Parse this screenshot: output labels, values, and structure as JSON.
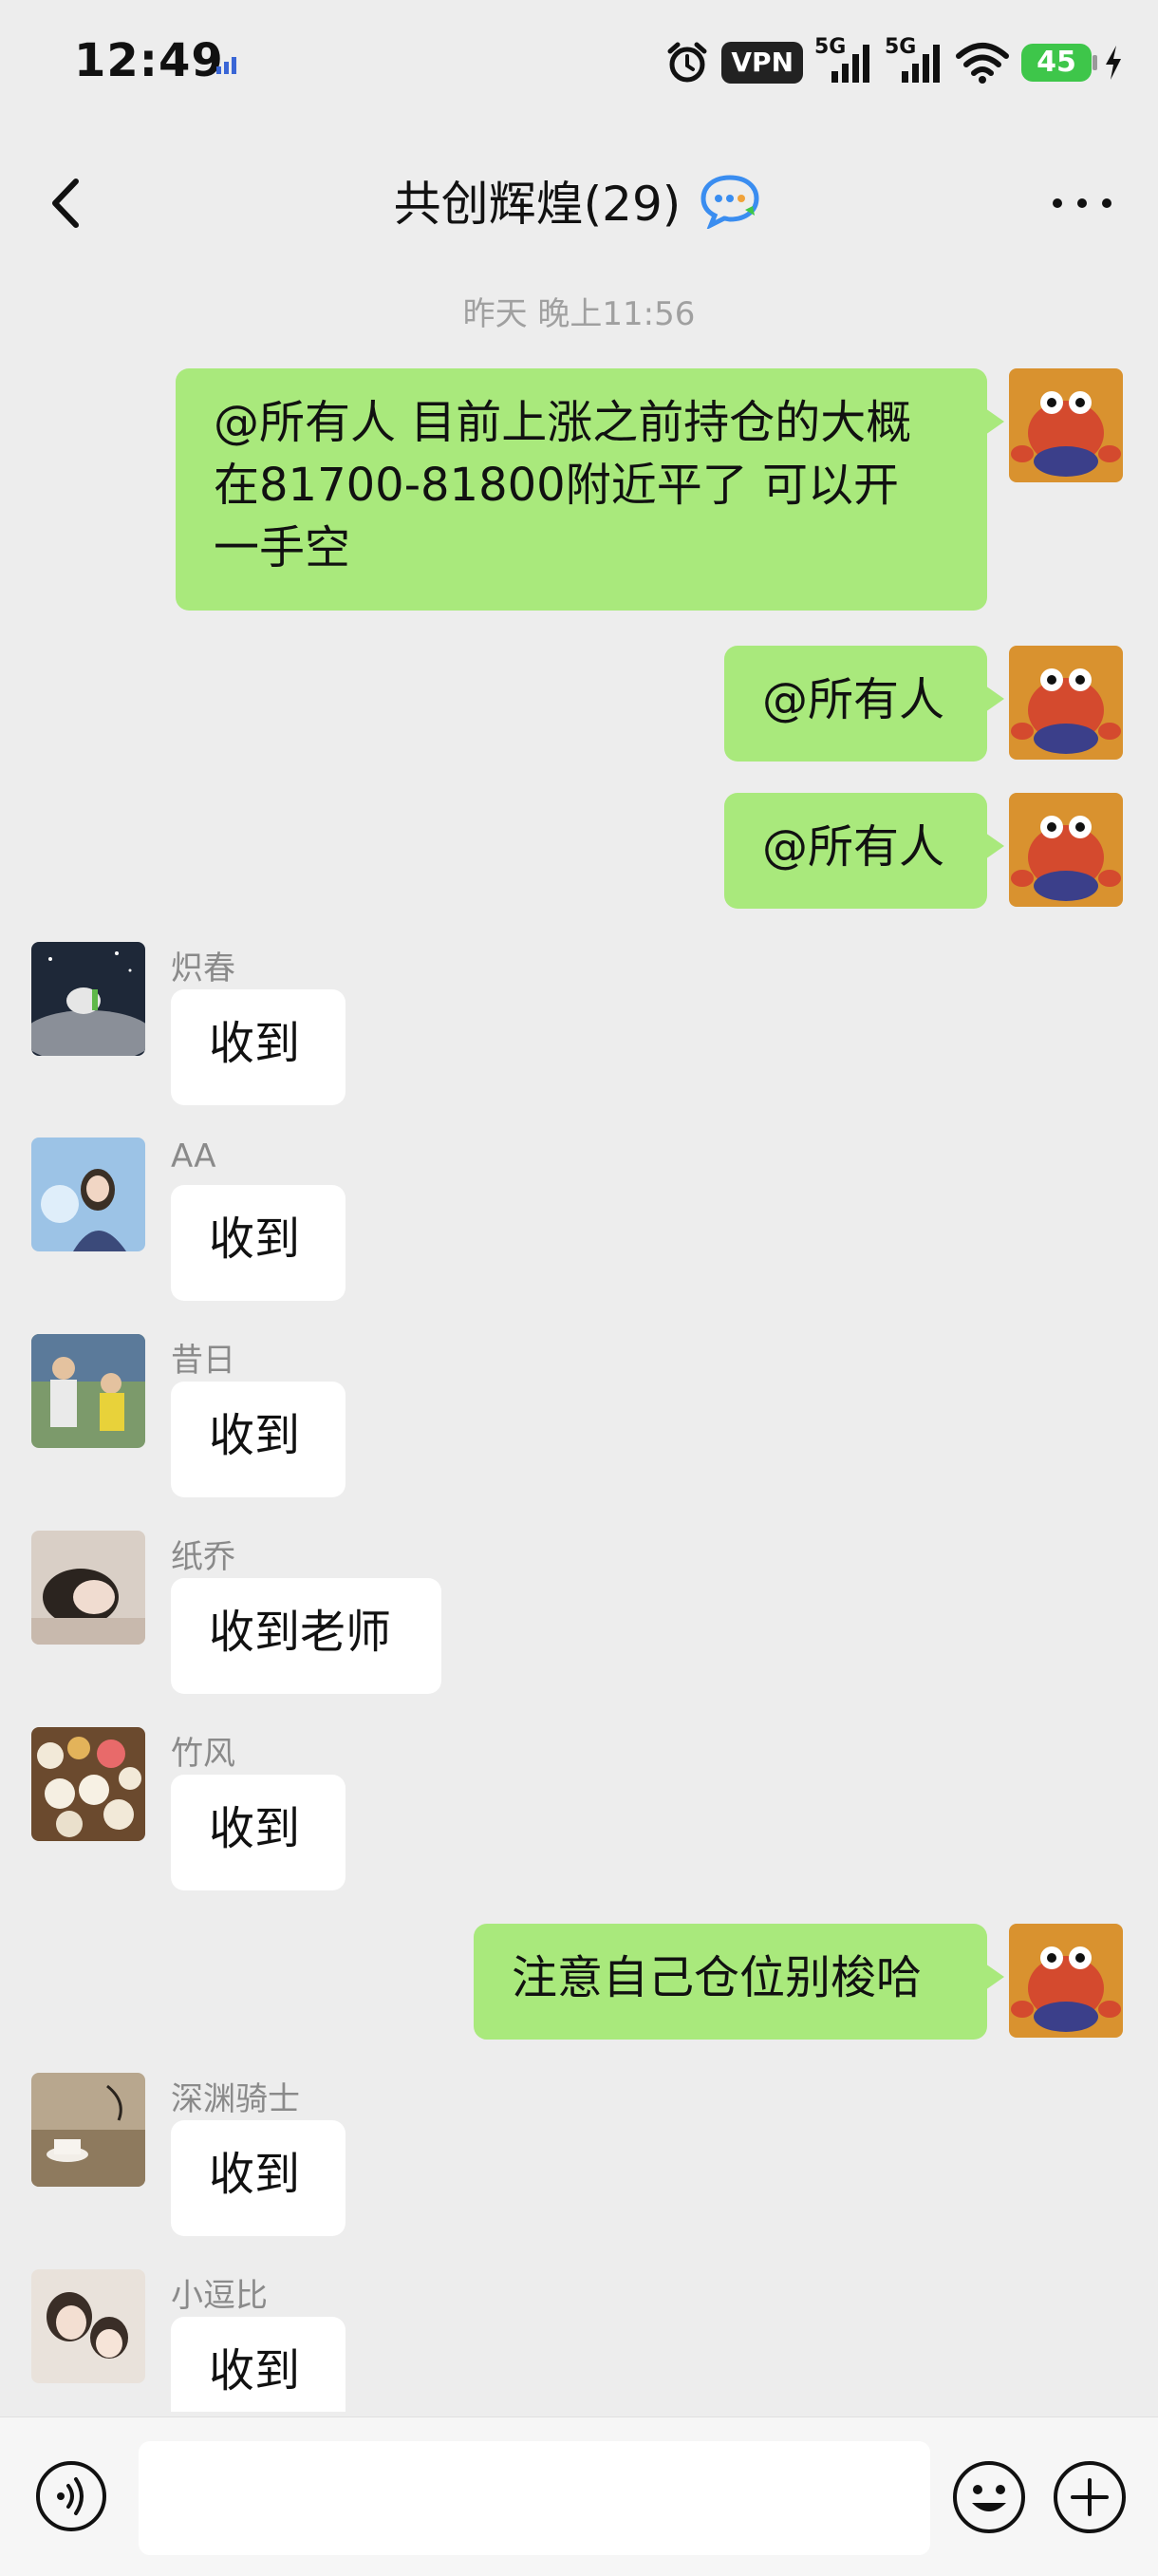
{
  "status_bar": {
    "time": "12:49",
    "vpn_label": "VPN",
    "sim1_label": "5G",
    "sim2_label": "5G",
    "battery_level": "45"
  },
  "nav": {
    "title": "共创辉煌(29)"
  },
  "chat": {
    "timestamp": "昨天 晚上11:56",
    "messages": [
      {
        "from": "me",
        "text_lines": [
          "@所有人 目前上涨之前持仓的大概",
          "在81700-81800附近平了 可以开",
          "一手空"
        ]
      },
      {
        "from": "me",
        "text": "@所有人"
      },
      {
        "from": "me",
        "text": "@所有人"
      },
      {
        "from": "them",
        "sender": "炽春",
        "text": "收到"
      },
      {
        "from": "them",
        "sender": "AA",
        "text": "收到"
      },
      {
        "from": "them",
        "sender": "昔日",
        "text": "收到"
      },
      {
        "from": "them",
        "sender": "纸乔",
        "text": "收到老师"
      },
      {
        "from": "them",
        "sender": "竹风",
        "text": "收到"
      },
      {
        "from": "me",
        "text": "注意自己仓位别梭哈"
      },
      {
        "from": "them",
        "sender": "深渊骑士",
        "text": "收到"
      },
      {
        "from": "them",
        "sender": "小逗比",
        "text": "收到"
      }
    ]
  },
  "input_bar": {
    "placeholder": ""
  },
  "colors": {
    "background": "#ededed",
    "my_bubble": "#a9e97c",
    "their_bubble": "#ffffff",
    "battery": "#3ec64a",
    "timestamp_text": "#a0a0a0"
  },
  "icons": [
    "back-arrow-icon",
    "group-chat-icon",
    "more-icon",
    "voice-icon",
    "emoji-icon",
    "plus-icon",
    "alarm-icon",
    "signal-icon",
    "wifi-icon",
    "charging-icon"
  ]
}
